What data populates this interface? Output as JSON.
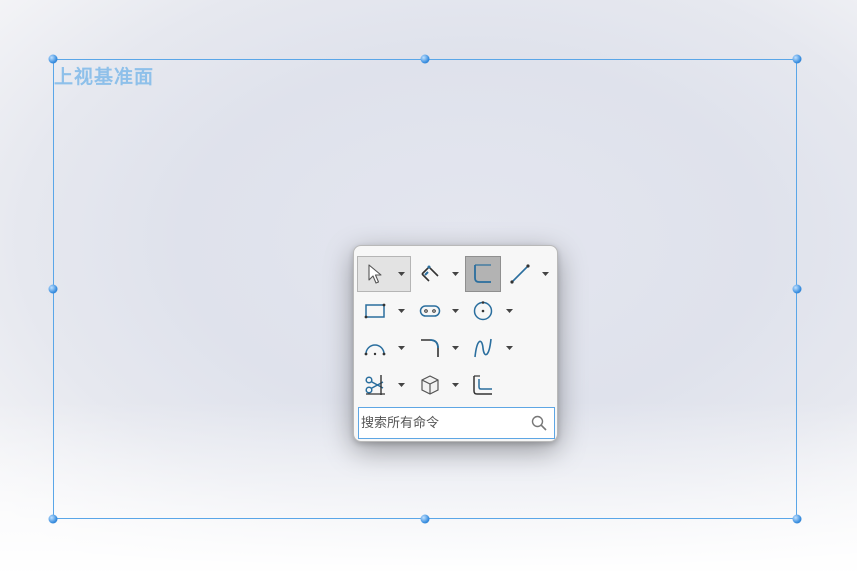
{
  "plane": {
    "label": "上视基准面",
    "border_color": "#5aa6e8"
  },
  "popup": {
    "tools": [
      {
        "name": "select",
        "icon": "select-arrow-icon",
        "state": "selected",
        "has_dropdown": true
      },
      {
        "name": "smart-dimension",
        "icon": "smart-dimension-icon",
        "has_dropdown": true
      },
      {
        "name": "sketch",
        "icon": "sketch-icon",
        "state": "pressed",
        "has_dropdown": false
      },
      {
        "name": "line",
        "icon": "line-icon",
        "has_dropdown": true
      },
      {
        "name": "rectangle",
        "icon": "rectangle-icon",
        "has_dropdown": true
      },
      {
        "name": "slot",
        "icon": "slot-icon",
        "has_dropdown": true
      },
      {
        "name": "circle",
        "icon": "circle-icon",
        "has_dropdown": true
      },
      {
        "name": "arc",
        "icon": "arc-icon",
        "has_dropdown": true
      },
      {
        "name": "fillet",
        "icon": "sketch-fillet-icon",
        "has_dropdown": true
      },
      {
        "name": "spline",
        "icon": "spline-icon",
        "has_dropdown": true
      },
      {
        "name": "trim",
        "icon": "trim-entities-icon",
        "has_dropdown": true
      },
      {
        "name": "3d-sketch",
        "icon": "cube-icon",
        "has_dropdown": true
      },
      {
        "name": "offset",
        "icon": "offset-entities-icon",
        "has_dropdown": false
      }
    ],
    "search": {
      "placeholder": "搜索所有命令",
      "value": "",
      "icon": "search-icon"
    }
  },
  "colors": {
    "accent": "#5ea6e4",
    "icon_blue": "#2a6e9e",
    "icon_dark": "#333333"
  }
}
